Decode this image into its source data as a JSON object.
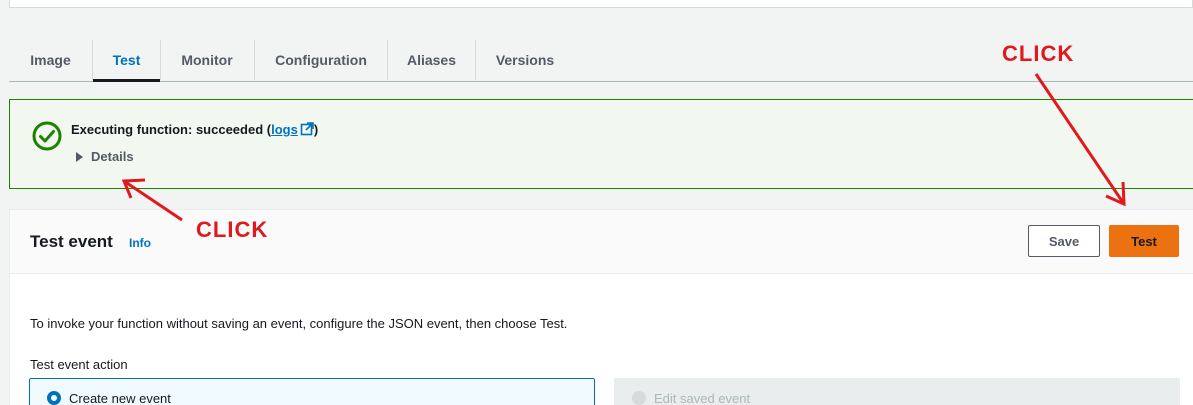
{
  "tabs": [
    {
      "label": "Image",
      "active": false
    },
    {
      "label": "Test",
      "active": true
    },
    {
      "label": "Monitor",
      "active": false
    },
    {
      "label": "Configuration",
      "active": false
    },
    {
      "label": "Aliases",
      "active": false
    },
    {
      "label": "Versions",
      "active": false
    }
  ],
  "alert": {
    "title_prefix": "Executing function: succeeded (",
    "logs_link": "logs",
    "title_suffix": ")",
    "details_label": "Details",
    "status_icon": "check-circle-icon",
    "status_color": "#1d8102"
  },
  "test_event": {
    "title": "Test event",
    "info_label": "Info",
    "save_label": "Save",
    "test_label": "Test",
    "description": "To invoke your function without saving an event, configure the JSON event, then choose Test.",
    "action_label": "Test event action",
    "options": [
      {
        "label": "Create new event",
        "selected": true,
        "disabled": false
      },
      {
        "label": "Edit saved event",
        "selected": false,
        "disabled": true
      }
    ]
  },
  "annotations": {
    "click_top": "CLICK",
    "click_bottom": "CLICK",
    "color": "#e0191e"
  },
  "colors": {
    "primary_button": "#ec7211",
    "link": "#0073bb",
    "success": "#1d8102"
  }
}
